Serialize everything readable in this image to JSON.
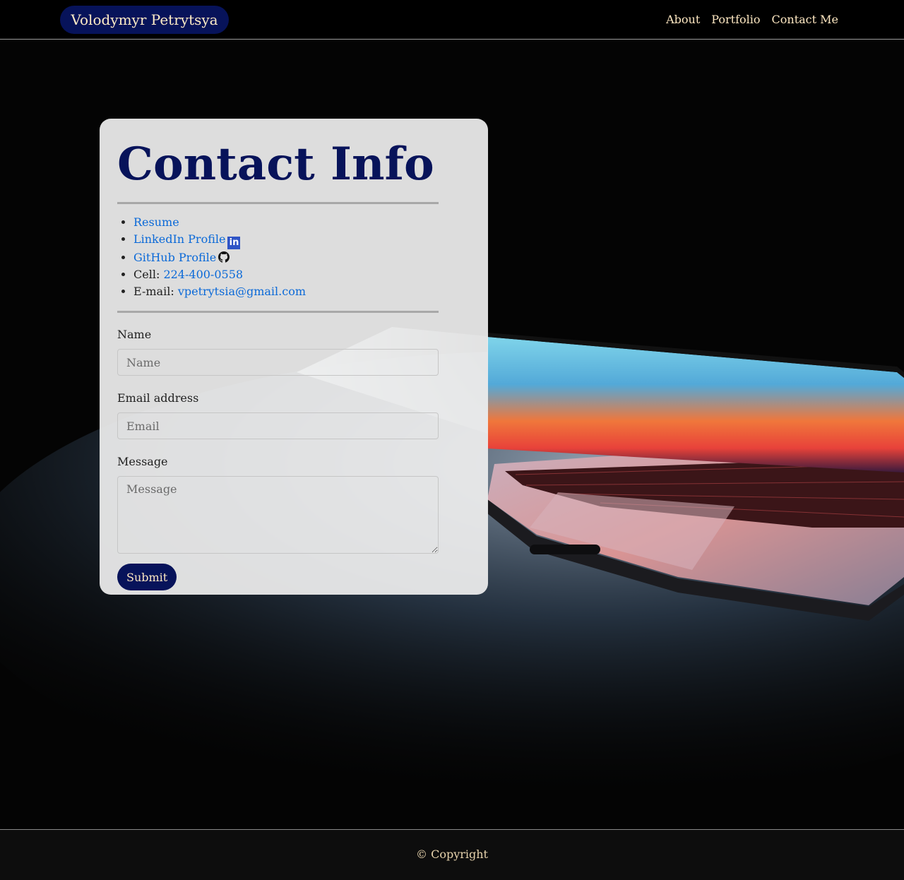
{
  "navbar": {
    "brand": "Volodymyr Petrytsya",
    "links": [
      "About",
      "Portfolio",
      "Contact Me"
    ]
  },
  "hero": {
    "background": "laptop-photo"
  },
  "contact": {
    "title": "Contact Info",
    "resume_link": "Resume",
    "linkedin_link": "LinkedIn Profile",
    "linkedin_icon": "linkedin-icon",
    "github_link": "GitHub Profile",
    "github_icon": "github-icon",
    "cell_label": "Cell:",
    "cell_value": "224-400-0558",
    "email_label": "E-mail:",
    "email_value": "vpetrytsia@gmail.com"
  },
  "form": {
    "name_label": "Name",
    "name_placeholder": "Name",
    "email_label": "Email address",
    "email_placeholder": "Email",
    "message_label": "Message",
    "message_placeholder": "Message",
    "submit_label": "Submit"
  },
  "footer": {
    "copyright": "© Copyright"
  },
  "colors": {
    "brand_navy": "#07135a",
    "nav_text": "#ffe8c2",
    "link_blue": "#0a69d8",
    "card_bg": "#eeeeee",
    "footer_text": "#e6d2ac"
  }
}
